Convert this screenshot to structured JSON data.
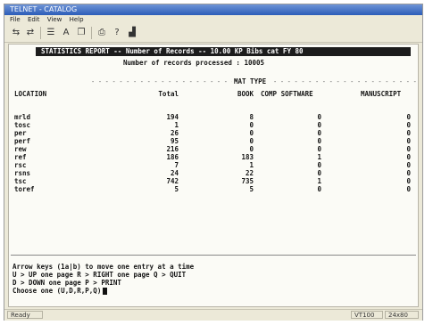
{
  "window": {
    "title": "TELNET - CATALOG"
  },
  "menubar": [
    "File",
    "Edit",
    "View",
    "Help"
  ],
  "toolbar_icons": [
    "connect-icon",
    "disconnect-icon",
    "properties-icon",
    "font-icon",
    "copy-icon",
    "print-icon",
    "help-icon",
    "chart-icon"
  ],
  "report": {
    "header": "STATISTICS REPORT -- Number of Records -- 10.00 KP Bibs cat FY 80",
    "records_line": "Number of records processed : 10005",
    "mat_type_label": "MAT TYPE",
    "columns": [
      "LOCATION",
      "Total",
      "BOOK",
      "COMP SOFTWARE",
      "MANUSCRIPT"
    ],
    "rows": [
      {
        "location": "mrld",
        "total": "194",
        "book": "8",
        "comp": "0",
        "manu": "0"
      },
      {
        "location": "tosc",
        "total": "1",
        "book": "0",
        "comp": "0",
        "manu": "0"
      },
      {
        "location": "per",
        "total": "26",
        "book": "0",
        "comp": "0",
        "manu": "0"
      },
      {
        "location": "perf",
        "total": "95",
        "book": "0",
        "comp": "0",
        "manu": "0"
      },
      {
        "location": "rew",
        "total": "216",
        "book": "0",
        "comp": "0",
        "manu": "0"
      },
      {
        "location": "ref",
        "total": "186",
        "book": "183",
        "comp": "1",
        "manu": "0"
      },
      {
        "location": "rsc",
        "total": "7",
        "book": "1",
        "comp": "0",
        "manu": "0"
      },
      {
        "location": "rsns",
        "total": "24",
        "book": "22",
        "comp": "0",
        "manu": "0"
      },
      {
        "location": "tsc",
        "total": "742",
        "book": "735",
        "comp": "1",
        "manu": "0"
      },
      {
        "location": "toref",
        "total": "5",
        "book": "5",
        "comp": "0",
        "manu": "0"
      }
    ],
    "help_lines": [
      "Arrow keys (1a|b) to move one entry at a time",
      "U > UP one page      R > RIGHT one page     Q > QUIT",
      "D > DOWN one page    P > PRINT"
    ],
    "prompt": "Choose one (U,D,R,P,Q)"
  },
  "status": {
    "left": "Ready",
    "mid": "VT100",
    "right": "24x80"
  }
}
